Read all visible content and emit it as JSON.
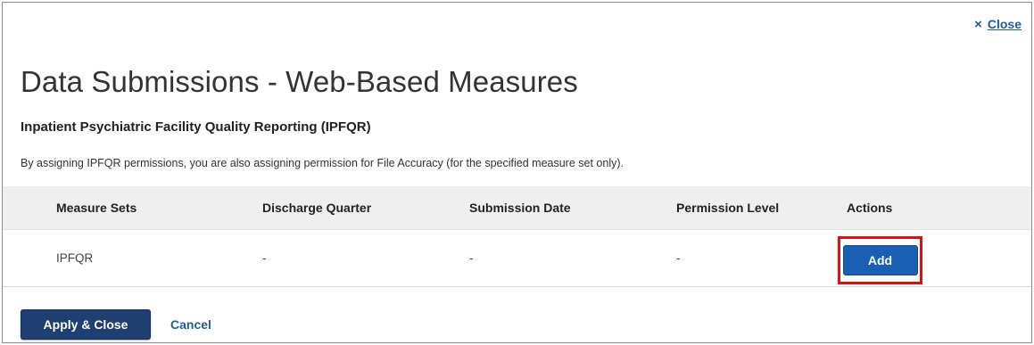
{
  "header": {
    "close_label": "Close",
    "close_icon": "×"
  },
  "title": "Data Submissions - Web-Based Measures",
  "subtitle": "Inpatient Psychiatric Facility Quality Reporting (IPFQR)",
  "note": "By assigning IPFQR permissions, you are also assigning permission for File Accuracy (for the specified measure set only).",
  "table": {
    "columns": [
      "Measure Sets",
      "Discharge Quarter",
      "Submission Date",
      "Permission Level",
      "Actions"
    ],
    "rows": [
      {
        "measure_set": "IPFQR",
        "discharge_quarter": "-",
        "submission_date": "-",
        "permission_level": "-",
        "action_label": "Add"
      }
    ]
  },
  "footer": {
    "apply_label": "Apply & Close",
    "cancel_label": "Cancel"
  },
  "colors": {
    "link": "#1f5c99",
    "primary_button": "#1f3f73",
    "action_button": "#1a5fb4",
    "highlight": "#e01010",
    "table_header_bg": "#efefef"
  }
}
